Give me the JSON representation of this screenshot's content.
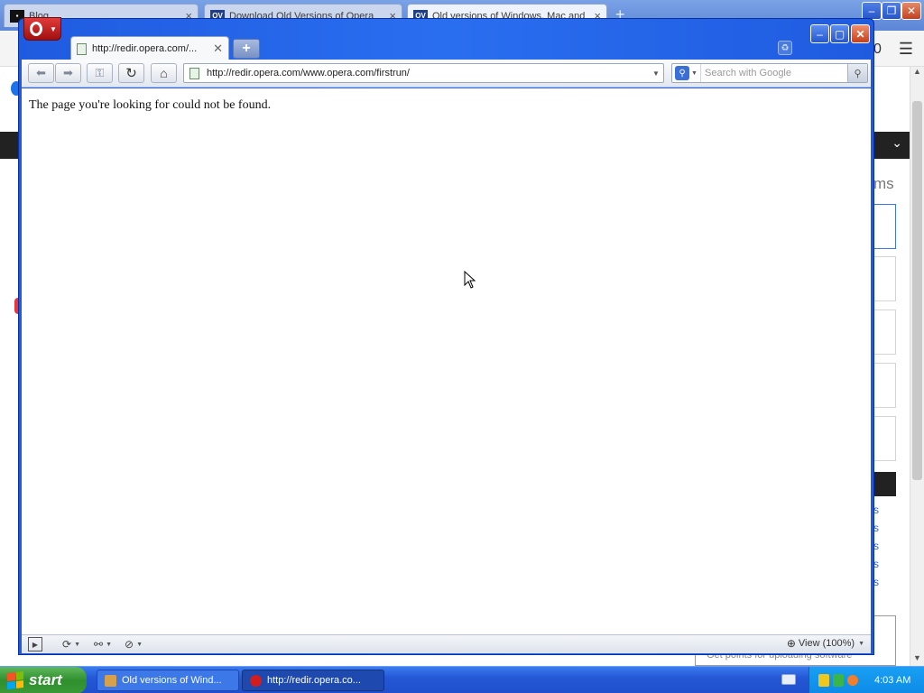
{
  "background_browser": {
    "tabs": [
      {
        "label": "Blog",
        "favicon": "blog-favicon",
        "active": false
      },
      {
        "label": "Download Old Versions of Opera",
        "favicon": "OV",
        "active": false
      },
      {
        "label": "Old versions of Windows, Mac and",
        "favicon": "OV",
        "active": true
      }
    ],
    "close_glyph": "×",
    "new_tab_glyph": "+",
    "right_text_fragment": "ms",
    "count_badge": "0",
    "link_fragment": "s",
    "footer_text": "Get points for uploading software"
  },
  "opera": {
    "tab_title": "http://redir.opera.com/...",
    "address_url": "http://redir.opera.com/www.opera.com/firstrun/",
    "search_placeholder": "Search with Google",
    "message": "The page you're looking for could not be found.",
    "zoom_label": "View (100%)",
    "colors": {
      "frame": "#1f5be0",
      "logo": "#d31c1c",
      "close": "#c7401a"
    }
  },
  "taskbar": {
    "start_label": "start",
    "tasks": [
      {
        "label": "Old versions of Wind...",
        "icon": "opera-old-versions-icon"
      },
      {
        "label": "http://redir.opera.co...",
        "icon": "opera-icon"
      }
    ],
    "clock": "4:03 AM"
  }
}
